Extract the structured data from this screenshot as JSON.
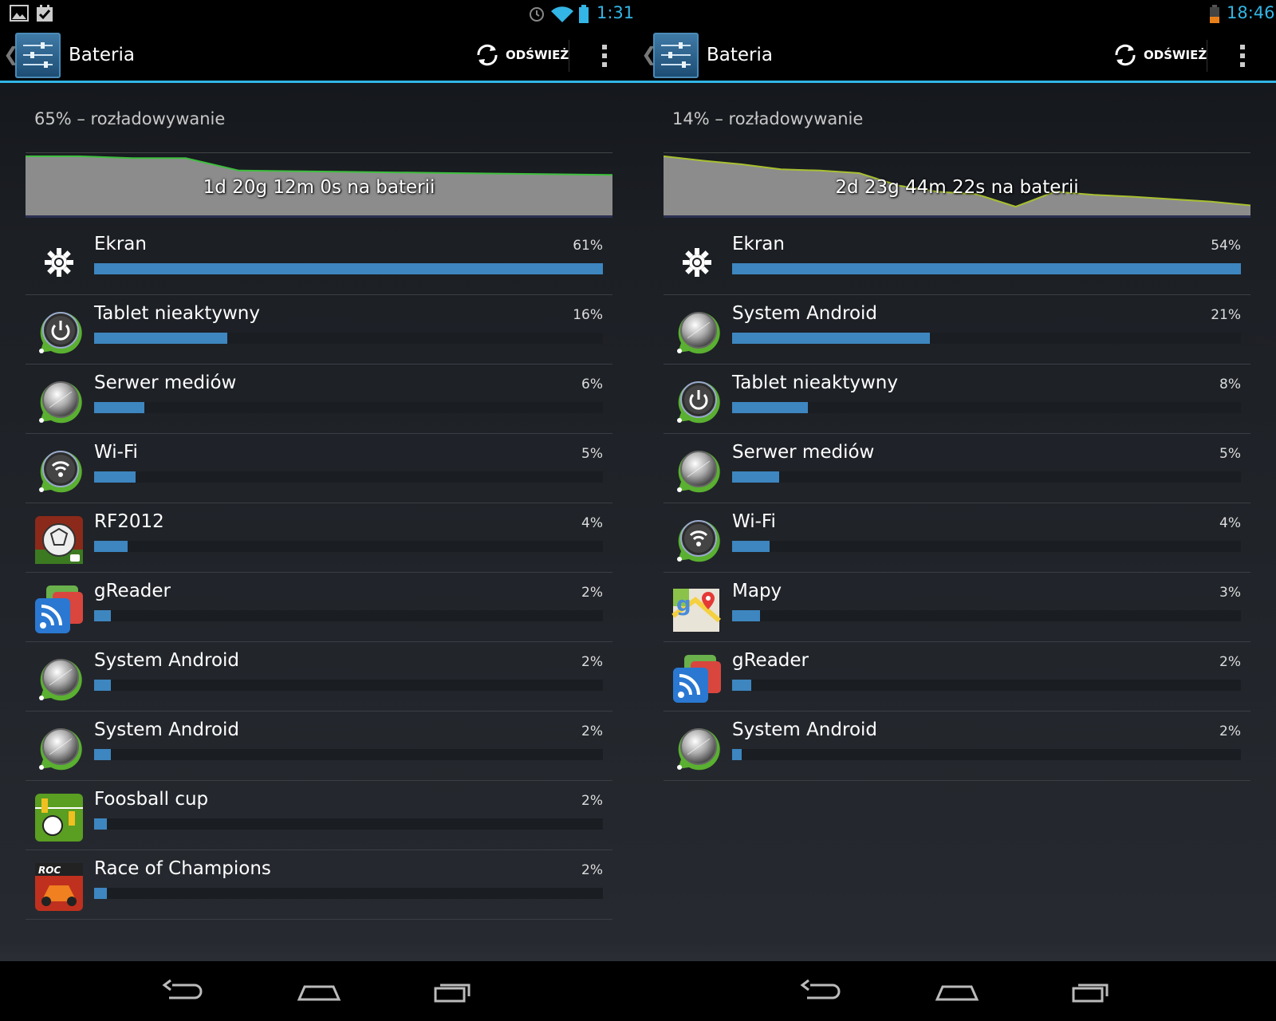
{
  "screens": [
    {
      "status": {
        "time": "1:31"
      },
      "title": "Bateria",
      "refresh_label": "ODŚWIEŻ",
      "summary": "65% – rozładowywanie",
      "graph_label": "1d 20g 12m 0s na baterii",
      "graph_levels": [
        0.95,
        0.95,
        0.92,
        0.92,
        0.72,
        0.71,
        0.7,
        0.69,
        0.68,
        0.67,
        0.66,
        0.65
      ],
      "items": [
        {
          "icon": "brightness-icon",
          "name": "Ekran",
          "pct": "61%",
          "value": 61
        },
        {
          "icon": "power-icon",
          "name": "Tablet nieaktywny",
          "pct": "16%",
          "value": 16
        },
        {
          "icon": "android-system-icon",
          "name": "Serwer mediów",
          "pct": "6%",
          "value": 6
        },
        {
          "icon": "wifi-icon",
          "name": "Wi-Fi",
          "pct": "5%",
          "value": 5
        },
        {
          "icon": "rf2012-app-icon",
          "name": "RF2012",
          "pct": "4%",
          "value": 4
        },
        {
          "icon": "greader-app-icon",
          "name": "gReader",
          "pct": "2%",
          "value": 2
        },
        {
          "icon": "android-system-icon",
          "name": "System Android",
          "pct": "2%",
          "value": 2
        },
        {
          "icon": "android-system-icon",
          "name": "System Android",
          "pct": "2%",
          "value": 2
        },
        {
          "icon": "foosball-app-icon",
          "name": "Foosball cup",
          "pct": "2%",
          "value": 1.5
        },
        {
          "icon": "roc-app-icon",
          "name": "Race of Champions",
          "pct": "2%",
          "value": 1.5
        }
      ]
    },
    {
      "status": {
        "time": "18:46"
      },
      "title": "Bateria",
      "refresh_label": "ODŚWIEŻ",
      "summary": "14% – rozładowywanie",
      "graph_label": "2d 23g 44m 22s na baterii",
      "graph_levels": [
        0.95,
        0.88,
        0.82,
        0.74,
        0.72,
        0.68,
        0.48,
        0.38,
        0.34,
        0.14,
        0.38,
        0.33,
        0.3,
        0.26,
        0.22,
        0.16
      ],
      "items": [
        {
          "icon": "brightness-icon",
          "name": "Ekran",
          "pct": "54%",
          "value": 54
        },
        {
          "icon": "android-system-icon",
          "name": "System Android",
          "pct": "21%",
          "value": 21
        },
        {
          "icon": "power-icon",
          "name": "Tablet nieaktywny",
          "pct": "8%",
          "value": 8
        },
        {
          "icon": "android-system-icon",
          "name": "Serwer mediów",
          "pct": "5%",
          "value": 5
        },
        {
          "icon": "wifi-icon",
          "name": "Wi-Fi",
          "pct": "4%",
          "value": 4
        },
        {
          "icon": "maps-app-icon",
          "name": "Mapy",
          "pct": "3%",
          "value": 3
        },
        {
          "icon": "greader-app-icon",
          "name": "gReader",
          "pct": "2%",
          "value": 2
        },
        {
          "icon": "android-system-icon",
          "name": "System Android",
          "pct": "2%",
          "value": 1
        }
      ]
    }
  ]
}
